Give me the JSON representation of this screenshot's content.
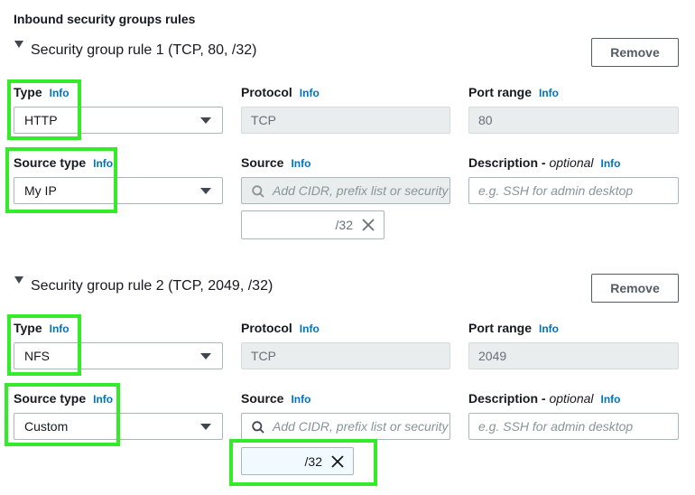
{
  "section_title": "Inbound security groups rules",
  "info_label": "Info",
  "remove_label": "Remove",
  "rules": [
    {
      "header": "Security group rule 1 (TCP, 80,                      /32)",
      "type_label": "Type",
      "type_value": "HTTP",
      "protocol_label": "Protocol",
      "protocol_value": "TCP",
      "port_label": "Port range",
      "port_value": "80",
      "source_type_label": "Source type",
      "source_type_value": "My IP",
      "source_label": "Source",
      "source_placeholder": "Add CIDR, prefix list or security",
      "cidr_token": "/32",
      "description_label": "Description - ",
      "description_optional": "optional",
      "description_placeholder": "e.g. SSH for admin desktop"
    },
    {
      "header": "Security group rule 2 (TCP, 2049,                  /32)",
      "type_label": "Type",
      "type_value": "NFS",
      "protocol_label": "Protocol",
      "protocol_value": "TCP",
      "port_label": "Port range",
      "port_value": "2049",
      "source_type_label": "Source type",
      "source_type_value": "Custom",
      "source_label": "Source",
      "source_placeholder": "Add CIDR, prefix list or security",
      "cidr_token": "/32",
      "description_label": "Description - ",
      "description_optional": "optional",
      "description_placeholder": "e.g. SSH for admin desktop"
    }
  ],
  "colors": {
    "highlight": "#34eb2a",
    "info_link": "#0073bb",
    "token_selected_bg": "#f1faff"
  }
}
